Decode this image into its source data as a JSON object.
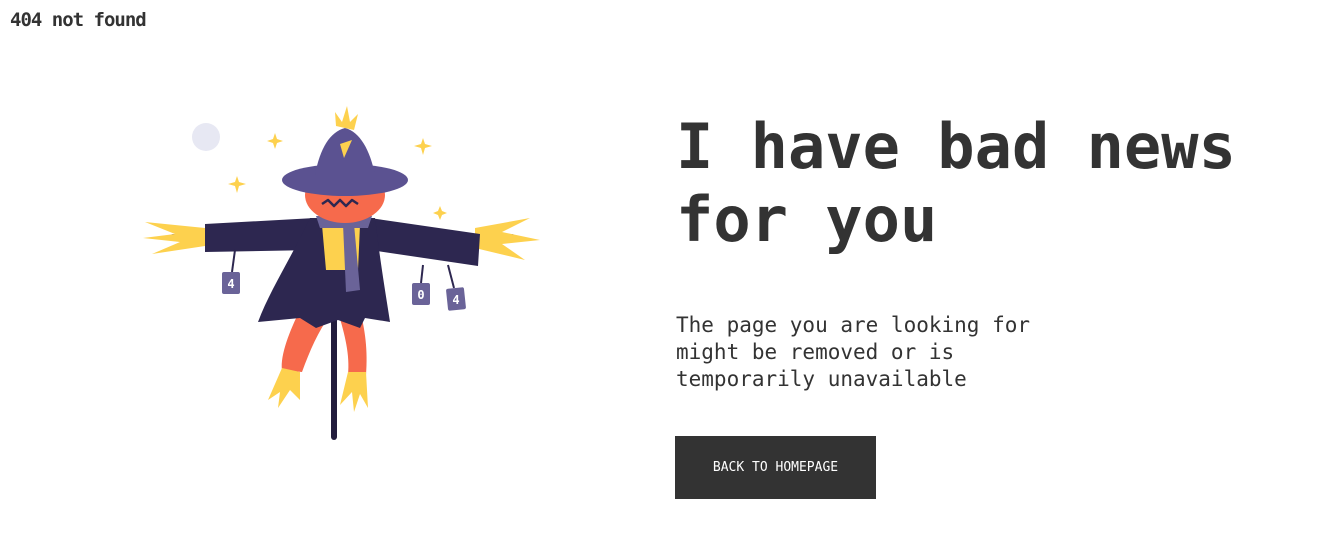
{
  "header": {
    "title": "404 not found"
  },
  "illustration": {
    "name": "scarecrow",
    "tag_labels": [
      "4",
      "0",
      "4"
    ],
    "colors": {
      "coat": "#2d2750",
      "hat": "#5b5291",
      "face": "#f66a4c",
      "straw": "#fdd14e",
      "scarf": "#6a6398",
      "moon": "#e7e8f3",
      "pole": "#221d3d"
    }
  },
  "main": {
    "headline": "I have bad news for you",
    "description": "The page you are looking for might be removed or is temporarily unavailable",
    "button_label": "BACK TO HOMEPAGE"
  },
  "colors": {
    "text": "#333333",
    "button_bg": "#333333",
    "button_text": "#ffffff",
    "background": "#ffffff"
  }
}
